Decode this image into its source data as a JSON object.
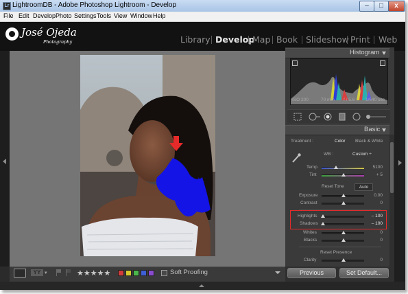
{
  "window": {
    "title": "LightroomDB - Adobe Photoshop Lightroom - Develop",
    "app_icon_text": "Lr",
    "min_label": "–",
    "max_label": "□",
    "close_label": "x"
  },
  "menubar": [
    "File",
    "Edit",
    "Develop",
    "Photo",
    "Settings",
    "Tools",
    "View",
    "Window",
    "Help"
  ],
  "branding": {
    "name": "José Ojeda",
    "tagline": "Photography"
  },
  "modules": [
    {
      "label": "Library",
      "active": false
    },
    {
      "label": "Develop",
      "active": true
    },
    {
      "label": "Map",
      "active": false
    },
    {
      "label": "Book",
      "active": false
    },
    {
      "label": "Slideshow",
      "active": false
    },
    {
      "label": "Print",
      "active": false
    },
    {
      "label": "Web",
      "active": false
    }
  ],
  "histogram": {
    "title": "Histogram",
    "iso": "ISO 200",
    "focal": "70 mm",
    "aperture": "f / 5.6",
    "shutter": "1/640 sec"
  },
  "basic": {
    "title": "Basic",
    "treatment_label": "Treatment :",
    "treatment_color": "Color",
    "treatment_bw": "Black & White",
    "wb_label": "WB :",
    "wb_value": "Custom ÷",
    "temp_label": "Temp",
    "temp_value": "5100",
    "tint_label": "Tint",
    "tint_value": "+ 5",
    "reset_tone": "Reset Tone",
    "auto": "Auto",
    "exposure_label": "Exposure",
    "exposure_value": "0.00",
    "contrast_label": "Contrast",
    "contrast_value": "0",
    "highlights_label": "Highlights",
    "highlights_value": "– 100",
    "shadows_label": "Shadows",
    "shadows_value": "– 100",
    "whites_label": "Whites",
    "whites_value": "0",
    "blacks_label": "Blacks",
    "blacks_value": "0",
    "reset_presence": "Reset Presence",
    "clarity_label": "Clarity",
    "clarity_value": "0"
  },
  "toolbar": {
    "stars": "★★★★★",
    "soft_proofing": "Soft Proofing"
  },
  "buttons": {
    "previous": "Previous",
    "set_default": "Set Default..."
  },
  "colors": {
    "clip_overlay": "#1414e6",
    "annotation_red": "#e52a2a",
    "swatches": [
      "#d33b3b",
      "#d6c92c",
      "#4bb84b",
      "#3f5fd6",
      "#8a4bcf"
    ]
  }
}
